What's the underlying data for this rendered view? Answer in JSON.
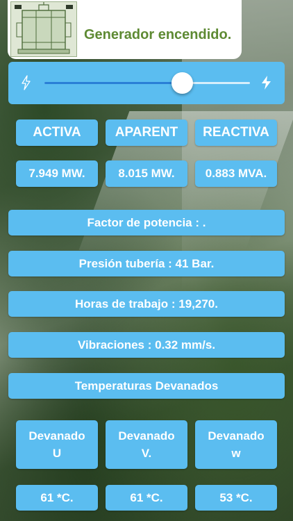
{
  "header": {
    "image_icon": "generator-icon",
    "status_text": "Generador encendido."
  },
  "slider": {
    "min_icon": "lightning-outline-icon",
    "max_icon": "lightning-filled-icon",
    "value_fraction": 0.67
  },
  "power": {
    "labels": [
      "ACTIVA",
      "APARENT",
      "REACTIVA"
    ],
    "values": [
      "7.949 MW.",
      "8.015 MW.",
      "0.883 MVA."
    ]
  },
  "info_rows": [
    "Factor de potencia : .",
    "Presión tubería : 41 Bar.",
    "Horas de trabajo : 19,270.",
    "Vibraciones : 0.32 mm/s.",
    "Temperaturas Devanados"
  ],
  "windings": [
    {
      "label": "Devanado",
      "phase": "U",
      "temp": "61 *C."
    },
    {
      "label": "Devanado",
      "phase": "V.",
      "temp": "61 *C."
    },
    {
      "label": "Devanado",
      "phase": "w",
      "temp": "53 *C."
    }
  ],
  "colors": {
    "button_blue": "#5bbdf0",
    "status_green": "#5e8a33",
    "slider_fill": "#2a7fd6"
  }
}
